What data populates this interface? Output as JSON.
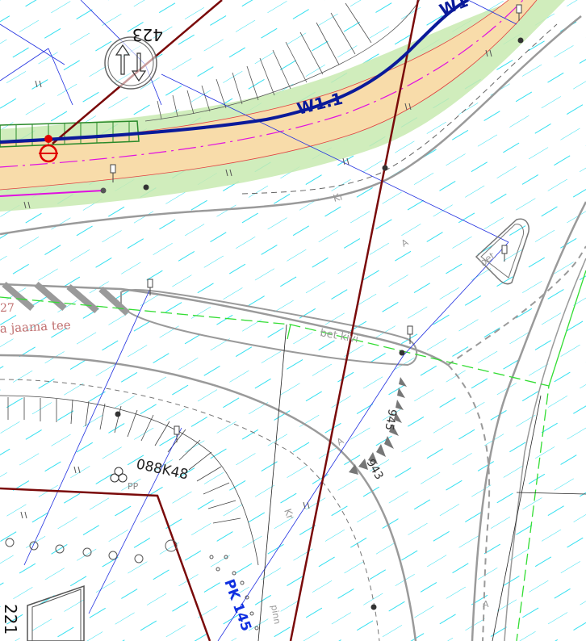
{
  "labels": {
    "pipe_w11": "W1.1",
    "pipe_w1": "W1",
    "parcel_423": "423",
    "parcel_221": "221",
    "kr_top": "Kr",
    "kr_bottom": "Kr",
    "a_top": "A",
    "a_mid": "A",
    "a_right": "A",
    "bet_kivi_island": "bet kivi",
    "bet_kivi_small": "bet",
    "street_name": "a jaama tee",
    "street_number": "27",
    "dim_945": "945",
    "dim_943": "943",
    "pole_code": "088K48",
    "pole_pp": "PP",
    "pk_station": "PK 145",
    "pinn": "pinn"
  },
  "colors": {
    "background": "#ffffff",
    "hatch": "#33e0f0",
    "water_pipe": "#0a1a9a",
    "boundary": "#7a0a0a",
    "kerb": "#9a9a9a",
    "green_strip": "#c8eab0",
    "road_fill": "#f8dcaa",
    "magenta_line": "#e010e0",
    "green_dash": "#33dd33",
    "hydrant": "#e00000"
  }
}
